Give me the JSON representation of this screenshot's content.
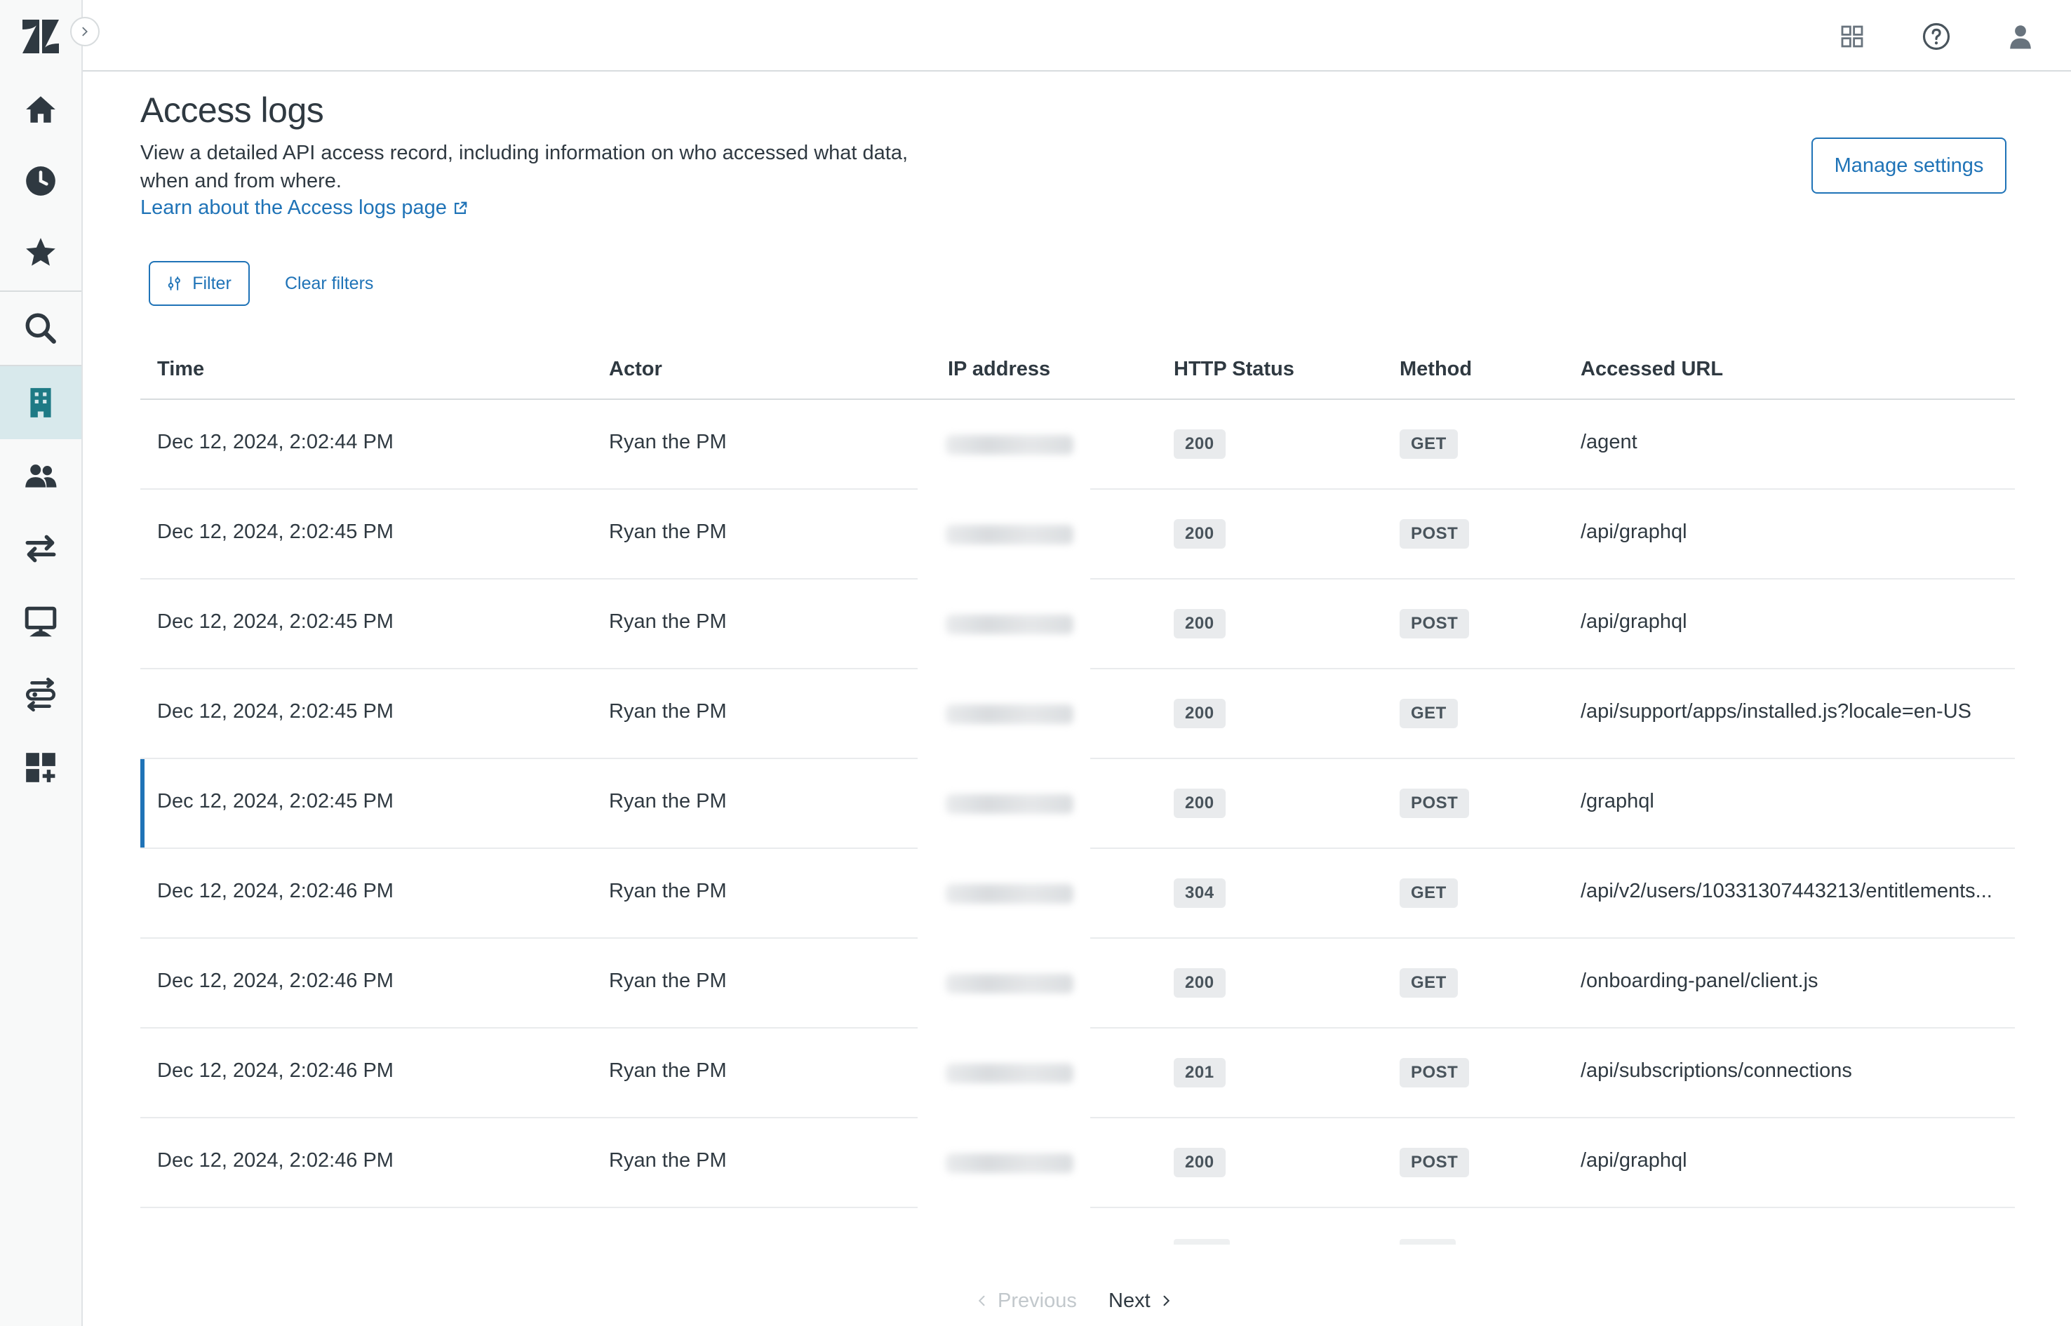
{
  "topbar": {
    "apps_icon": "grid-icon",
    "help_icon": "help-icon",
    "profile_icon": "user-icon"
  },
  "sidebar": {
    "logo": "zendesk-logo",
    "items": [
      {
        "name": "home",
        "icon": "home-icon"
      },
      {
        "name": "recent",
        "icon": "clock-icon"
      },
      {
        "name": "favorites",
        "icon": "star-icon"
      },
      {
        "name": "search",
        "icon": "search-icon"
      },
      {
        "name": "account",
        "icon": "building-icon",
        "active": true
      },
      {
        "name": "people",
        "icon": "people-icon"
      },
      {
        "name": "objects-rules",
        "icon": "transfer-icon"
      },
      {
        "name": "workspaces",
        "icon": "monitor-icon"
      },
      {
        "name": "routing",
        "icon": "routing-icon"
      },
      {
        "name": "apps-integrations",
        "icon": "apps-add-icon"
      }
    ]
  },
  "header": {
    "title": "Access logs",
    "description": "View a detailed API access record, including information on who accessed what data, when and from where.",
    "learn_link": "Learn about the Access logs page",
    "manage_button": "Manage settings"
  },
  "filters": {
    "filter_label": "Filter",
    "clear_label": "Clear filters"
  },
  "table": {
    "columns": [
      "Time",
      "Actor",
      "IP address",
      "HTTP Status",
      "Method",
      "Accessed URL"
    ],
    "rows": [
      {
        "time": "Dec 12, 2024, 2:02:44 PM",
        "actor": "Ryan the PM",
        "status": "200",
        "method": "GET",
        "url": "/agent"
      },
      {
        "time": "Dec 12, 2024, 2:02:45 PM",
        "actor": "Ryan the PM",
        "status": "200",
        "method": "POST",
        "url": "/api/graphql"
      },
      {
        "time": "Dec 12, 2024, 2:02:45 PM",
        "actor": "Ryan the PM",
        "status": "200",
        "method": "POST",
        "url": "/api/graphql"
      },
      {
        "time": "Dec 12, 2024, 2:02:45 PM",
        "actor": "Ryan the PM",
        "status": "200",
        "method": "GET",
        "url": "/api/support/apps/installed.js?locale=en-US"
      },
      {
        "time": "Dec 12, 2024, 2:02:45 PM",
        "actor": "Ryan the PM",
        "status": "200",
        "method": "POST",
        "url": "/graphql",
        "selected": true
      },
      {
        "time": "Dec 12, 2024, 2:02:46 PM",
        "actor": "Ryan the PM",
        "status": "304",
        "method": "GET",
        "url": "/api/v2/users/10331307443213/entitlements..."
      },
      {
        "time": "Dec 12, 2024, 2:02:46 PM",
        "actor": "Ryan the PM",
        "status": "200",
        "method": "GET",
        "url": "/onboarding-panel/client.js"
      },
      {
        "time": "Dec 12, 2024, 2:02:46 PM",
        "actor": "Ryan the PM",
        "status": "201",
        "method": "POST",
        "url": "/api/subscriptions/connections"
      },
      {
        "time": "Dec 12, 2024, 2:02:46 PM",
        "actor": "Ryan the PM",
        "status": "200",
        "method": "POST",
        "url": "/api/graphql"
      }
    ]
  },
  "pagination": {
    "previous": "Previous",
    "next": "Next"
  }
}
